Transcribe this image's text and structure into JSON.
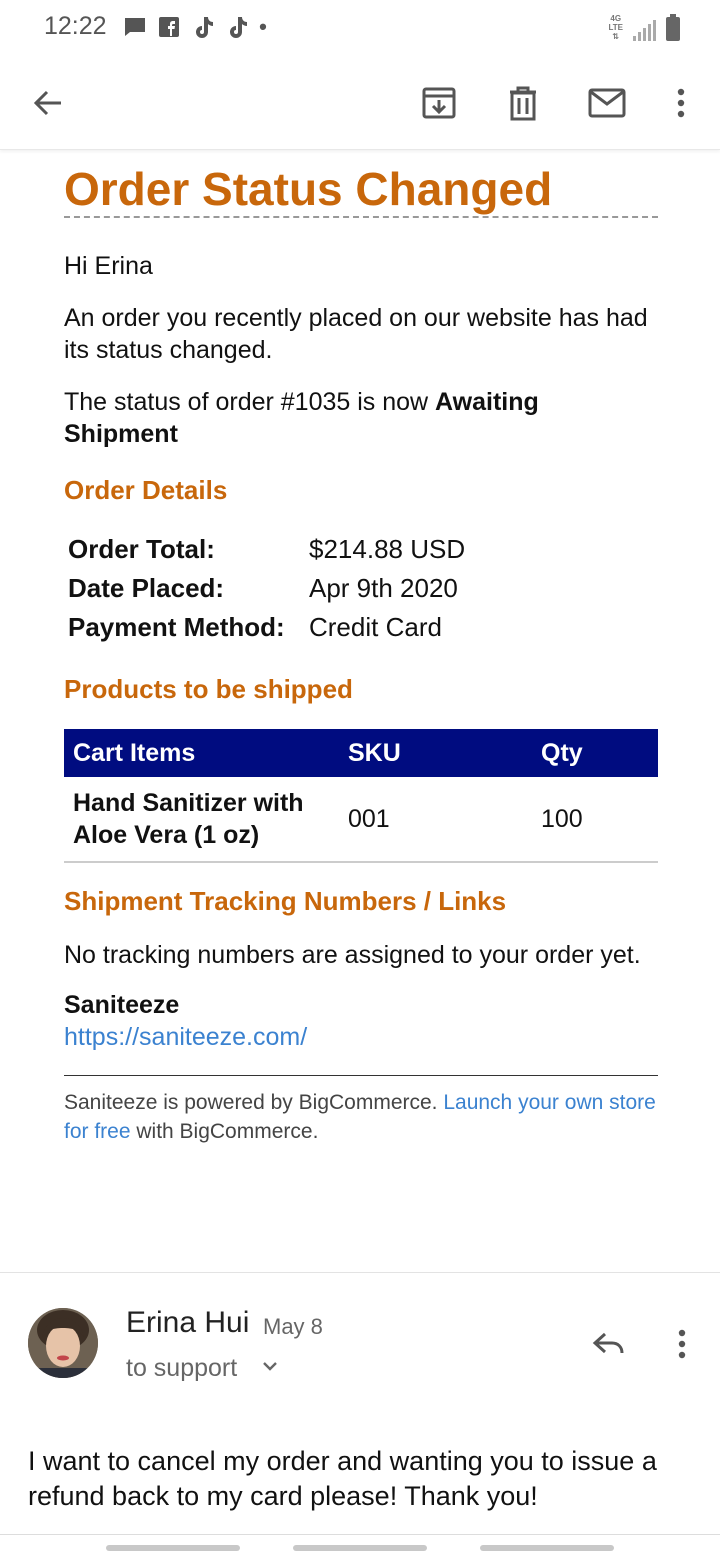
{
  "status_bar": {
    "time": "12:22",
    "network": "4G LTE"
  },
  "colors": {
    "accent_orange": "#c8670b",
    "table_header": "#000c80",
    "link_blue": "#3b82d0"
  },
  "toolbar": {
    "icons": [
      "back-arrow-icon",
      "archive-icon",
      "delete-icon",
      "mark-unread-icon",
      "more-vert-icon"
    ]
  },
  "email": {
    "title": "Order Status Changed",
    "greeting": "Hi Erina",
    "intro": "An order you recently placed on our website has had its status changed.",
    "status_prefix": "The status of order #1035 is now ",
    "status_value": "Awaiting Shipment",
    "order_details_heading": "Order Details",
    "details": [
      {
        "label": "Order Total:",
        "value": "$214.88 USD"
      },
      {
        "label": "Date Placed:",
        "value": "Apr 9th 2020"
      },
      {
        "label": "Payment Method:",
        "value": "Credit Card"
      }
    ],
    "products_heading": "Products to be shipped",
    "table_headers": [
      "Cart Items",
      "SKU",
      "Qty"
    ],
    "items": [
      {
        "name": "Hand Sanitizer with Aloe Vera (1 oz)",
        "sku": "001",
        "qty": "100"
      }
    ],
    "tracking_heading": "Shipment Tracking Numbers / Links",
    "tracking_text": "No tracking numbers are assigned to your order yet.",
    "store_name": "Saniteeze",
    "store_url": "https://saniteeze.com/",
    "footer_prefix": "Saniteeze is powered by BigCommerce. ",
    "footer_link": "Launch your own store for free",
    "footer_suffix": " with BigCommerce."
  },
  "reply": {
    "sender": "Erina Hui",
    "date": "May 8",
    "recipient": "to support",
    "body": "I want to cancel my order and wanting you to issue a refund back to my card please! Thank you!"
  }
}
